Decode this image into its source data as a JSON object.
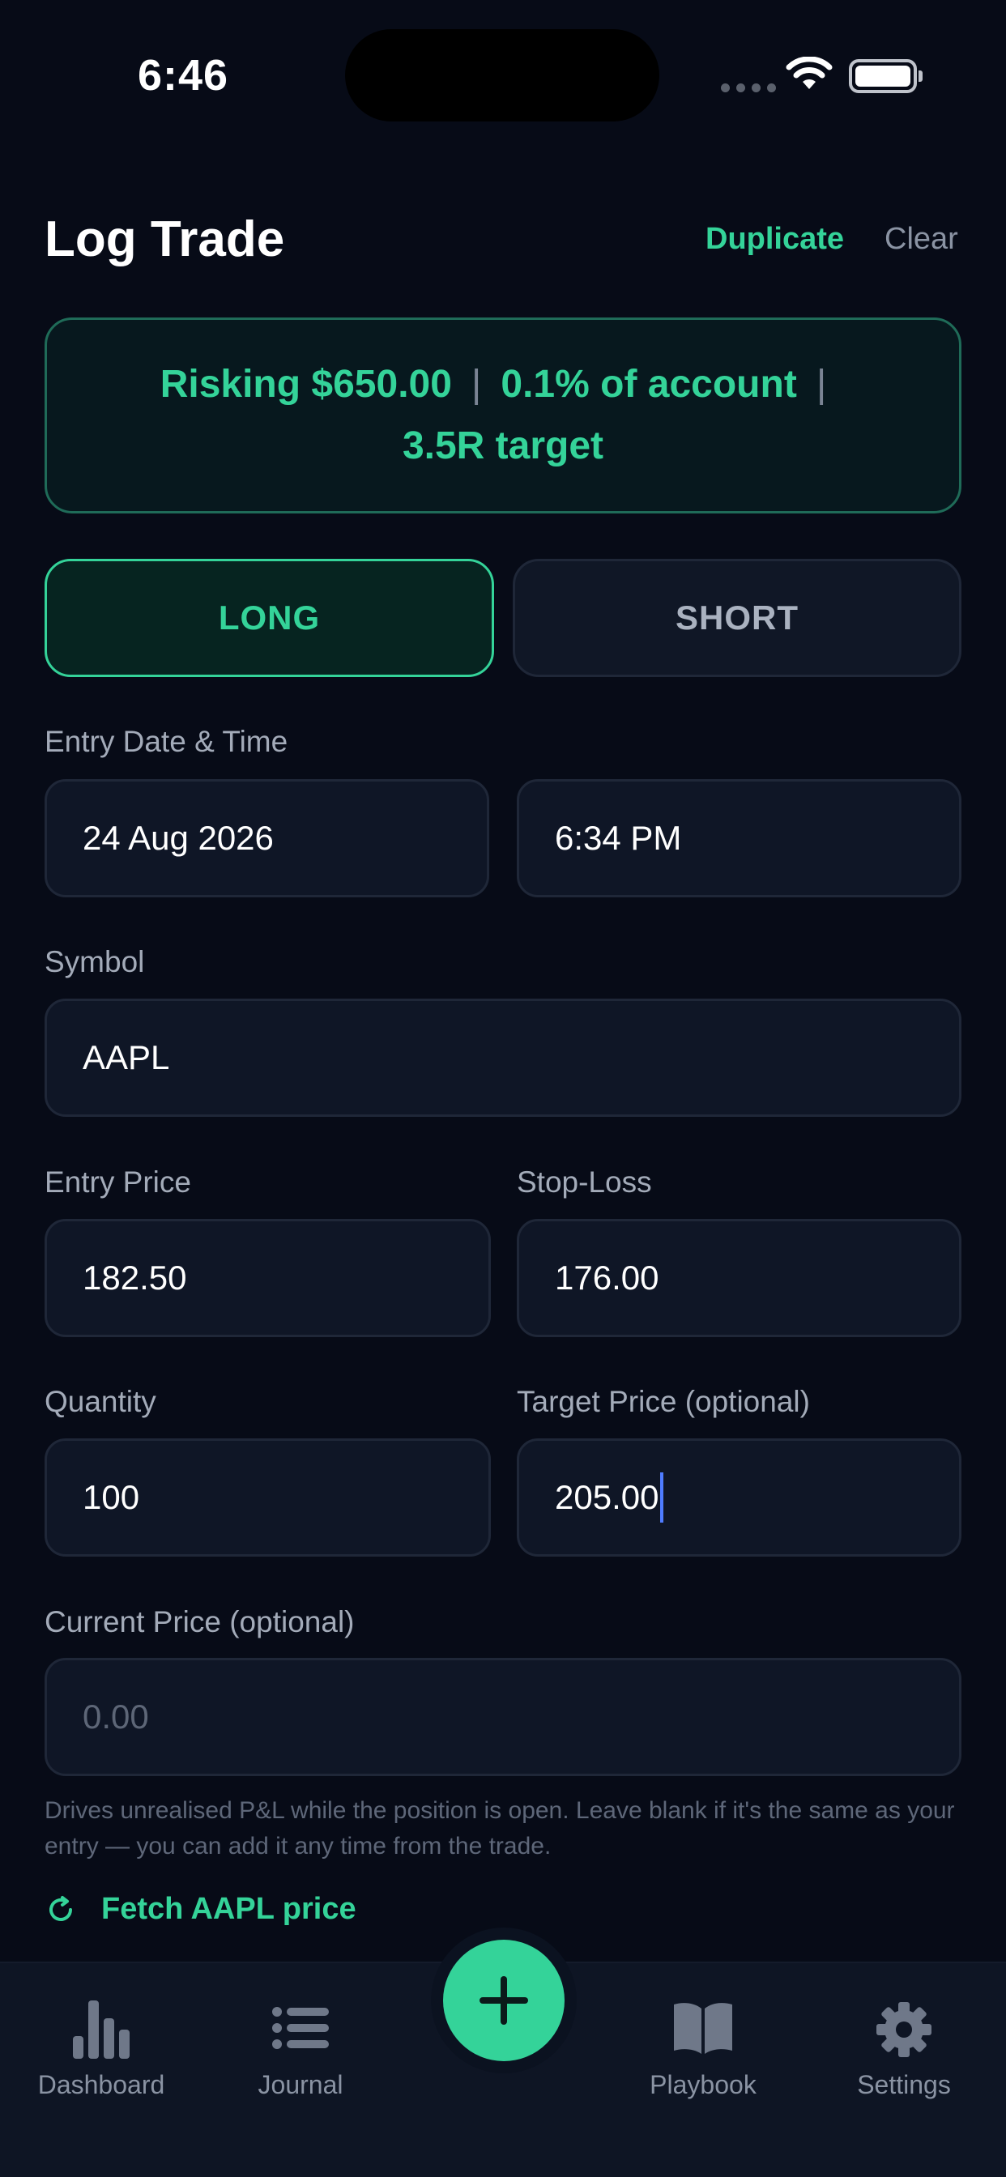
{
  "status": {
    "time": "6:46"
  },
  "header": {
    "title": "Log Trade",
    "duplicate_label": "Duplicate",
    "clear_label": "Clear"
  },
  "risk": {
    "risking": "Risking $650.00",
    "percent": "0.1% of account",
    "target": "3.5R target"
  },
  "direction": {
    "long_label": "LONG",
    "short_label": "SHORT",
    "selected": "LONG"
  },
  "form": {
    "entry_datetime_label": "Entry Date & Time",
    "entry_date": "24 Aug 2026",
    "entry_time": "6:34 PM",
    "symbol_label": "Symbol",
    "symbol": "AAPL",
    "entry_price_label": "Entry Price",
    "entry_price": "182.50",
    "stop_loss_label": "Stop-Loss",
    "stop_loss": "176.00",
    "quantity_label": "Quantity",
    "quantity": "100",
    "target_price_label": "Target Price (optional)",
    "target_price": "205.00",
    "current_price_label": "Current Price (optional)",
    "current_price_placeholder": "0.00",
    "helper_text": "Drives unrealised P&L while the position is open. Leave blank if it's the same as your entry — you can add it any time from the trade.",
    "fetch_label": "Fetch AAPL price"
  },
  "tabs": {
    "dashboard": "Dashboard",
    "journal": "Journal",
    "playbook": "Playbook",
    "settings": "Settings"
  },
  "colors": {
    "accent": "#34d399",
    "background": "#070b17",
    "field": "#0f1626",
    "caret": "#4f7cff"
  },
  "icons": {
    "dashboard": "bar-chart-icon",
    "journal": "list-icon",
    "playbook": "book-icon",
    "settings": "gear-icon",
    "fab": "plus-icon",
    "fetch": "refresh-icon"
  }
}
